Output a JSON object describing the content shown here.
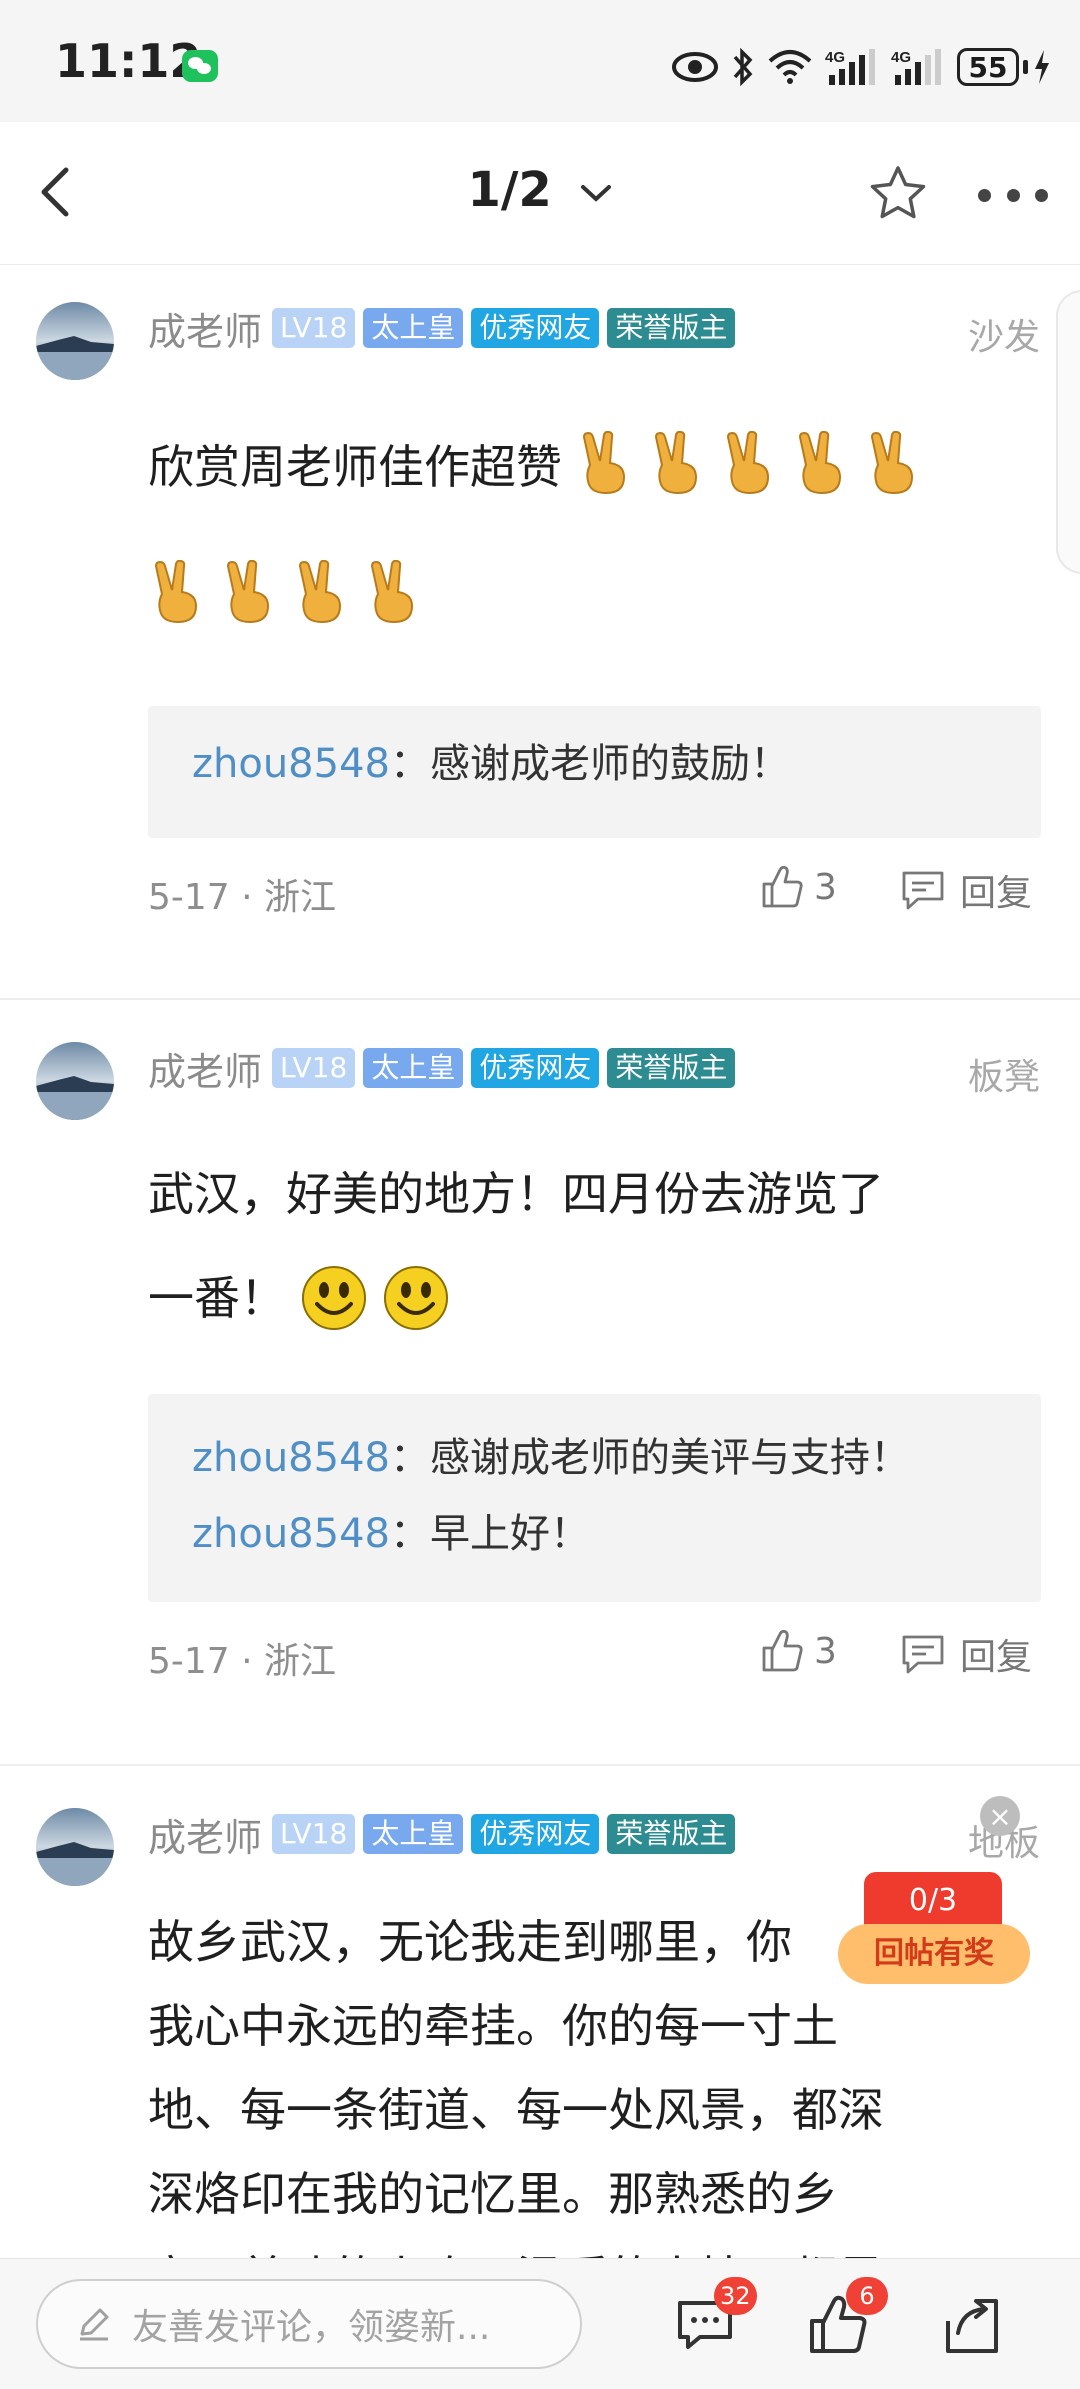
{
  "status_bar": {
    "time": "11:12",
    "battery": "55"
  },
  "nav": {
    "page_indicator": "1/2"
  },
  "comments": [
    {
      "username": "成老师",
      "tags": [
        "LV18",
        "太上皇",
        "优秀网友",
        "荣誉版主"
      ],
      "floor": "沙发",
      "text": "欣赏周老师佳作超赞",
      "emoji_count": 9,
      "replies": [
        {
          "user": "zhou8548",
          "sep": "：",
          "text": "感谢成老师的鼓励！"
        }
      ],
      "date": "5-17",
      "location": "浙江",
      "likes": "3",
      "reply_label": "回复"
    },
    {
      "username": "成老师",
      "tags": [
        "LV18",
        "太上皇",
        "优秀网友",
        "荣誉版主"
      ],
      "floor": "板凳",
      "text_line1": "武汉，好美的地方！四月份去游览了",
      "text_line2": "一番！",
      "replies": [
        {
          "user": "zhou8548",
          "sep": "：",
          "text": "感谢成老师的美评与支持！"
        },
        {
          "user": "zhou8548",
          "sep": "：",
          "text": "早上好！"
        }
      ],
      "date": "5-17",
      "location": "浙江",
      "likes": "3",
      "reply_label": "回复"
    },
    {
      "username": "成老师",
      "tags": [
        "LV18",
        "太上皇",
        "优秀网友",
        "荣誉版主"
      ],
      "floor": "地板",
      "lines": [
        "故乡武汉，无论我走到哪里，你",
        "我心中永远的牵挂。你的每一寸土",
        "地、每一条街道、每一处风景，都深",
        "深烙印在我的记忆里。那熟悉的乡",
        "音、美味的小吃、温暖的人情，都是"
      ]
    }
  ],
  "reward": {
    "progress": "0/3",
    "label": "回帖有奖",
    "close": "×"
  },
  "bottom_bar": {
    "input_placeholder": "友善发评论，领婆新...",
    "comment_count": "32",
    "like_count": "6"
  },
  "colors": {
    "accent_blue": "#4f8fc6",
    "badge_red": "#ef4135",
    "reward_orange": "#ffbe6b"
  }
}
